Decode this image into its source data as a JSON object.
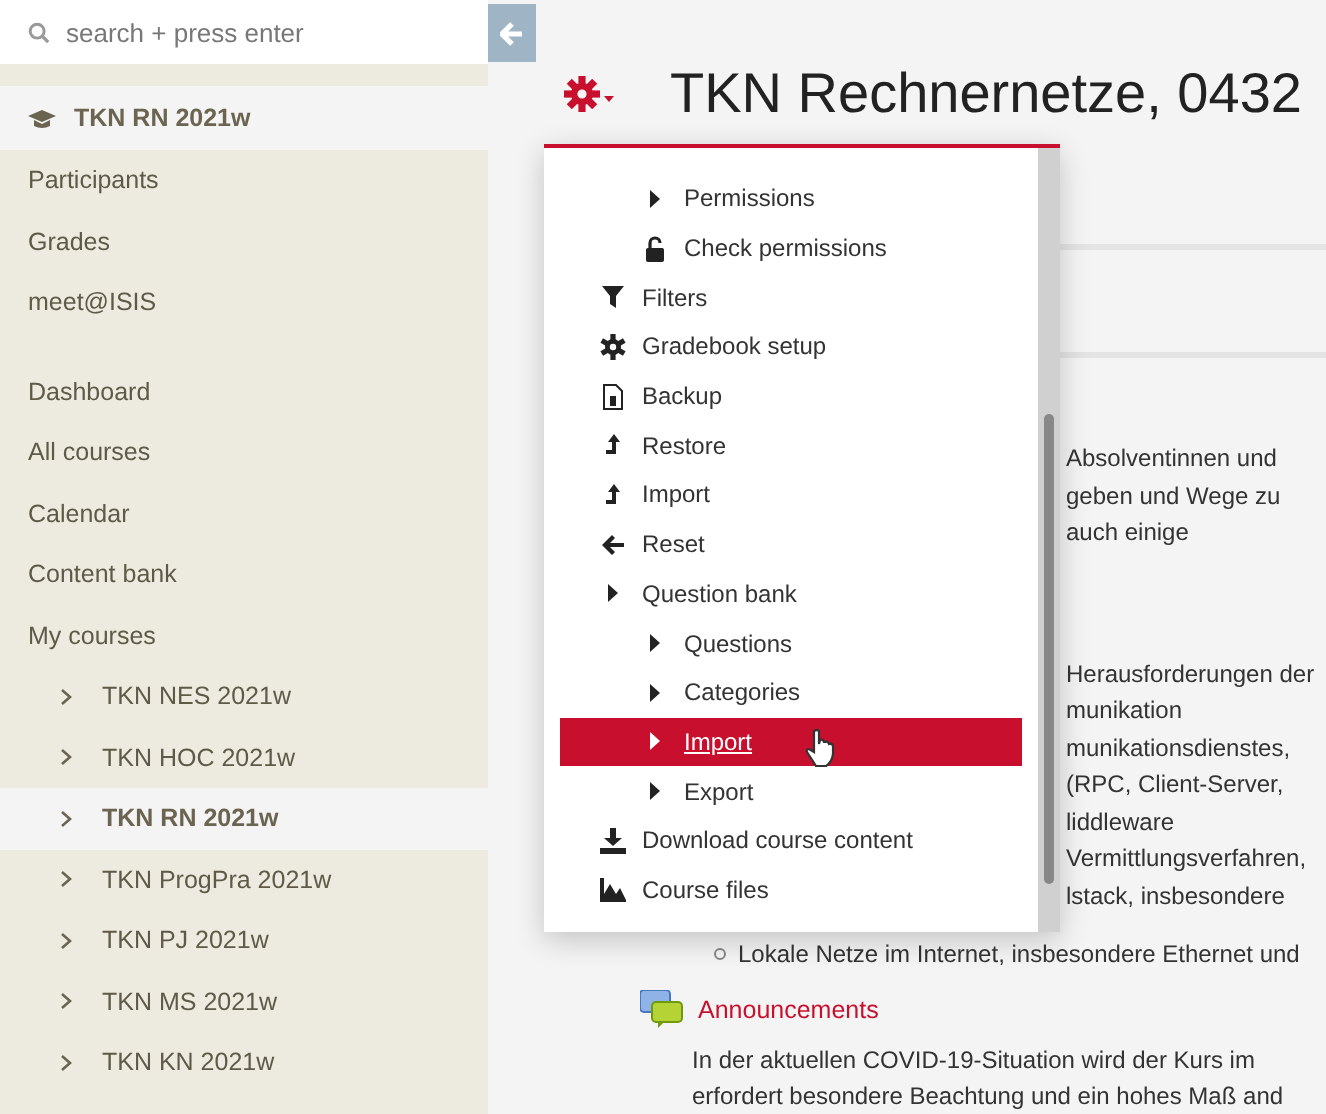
{
  "search": {
    "placeholder": "search + press enter"
  },
  "course_header": {
    "label": "TKN RN 2021w"
  },
  "nav_groups": [
    {
      "items": [
        {
          "label": "Participants"
        },
        {
          "label": "Grades"
        },
        {
          "label": "meet@ISIS"
        }
      ]
    },
    {
      "items": [
        {
          "label": "Dashboard"
        },
        {
          "label": "All courses"
        },
        {
          "label": "Calendar"
        },
        {
          "label": "Content bank"
        },
        {
          "label": "My courses",
          "children": [
            {
              "label": "TKN NES 2021w",
              "selected": false
            },
            {
              "label": "TKN HOC 2021w",
              "selected": false
            },
            {
              "label": "TKN RN 2021w",
              "selected": true
            },
            {
              "label": "TKN ProgPra 2021w",
              "selected": false
            },
            {
              "label": "TKN PJ 2021w",
              "selected": false
            },
            {
              "label": "TKN MS 2021w",
              "selected": false
            },
            {
              "label": "TKN KN 2021w",
              "selected": false
            }
          ]
        }
      ]
    }
  ],
  "page": {
    "title": "TKN Rechnernetze, 0432"
  },
  "menu": {
    "continued_children": [
      {
        "label": "Permissions",
        "kind": "caret",
        "selected": false
      },
      {
        "label": "Check permissions",
        "kind": "lock",
        "selected": false
      }
    ],
    "items": [
      {
        "label": "Filters",
        "kind": "filter",
        "selected": false
      },
      {
        "label": "Gradebook setup",
        "kind": "gear",
        "selected": false
      },
      {
        "label": "Backup",
        "kind": "file",
        "selected": false
      },
      {
        "label": "Restore",
        "kind": "up",
        "selected": false
      },
      {
        "label": "Import",
        "kind": "up",
        "selected": false
      },
      {
        "label": "Reset",
        "kind": "back",
        "selected": false
      },
      {
        "label": "Question bank",
        "kind": "caret",
        "selected": false,
        "children": [
          {
            "label": "Questions",
            "kind": "caret",
            "selected": false
          },
          {
            "label": "Categories",
            "kind": "caret",
            "selected": false
          },
          {
            "label": "Import",
            "kind": "caret",
            "selected": true
          },
          {
            "label": "Export",
            "kind": "caret",
            "selected": false
          }
        ]
      },
      {
        "label": "Download course content",
        "kind": "download",
        "selected": false
      },
      {
        "label": "Course files",
        "kind": "chart",
        "selected": false
      }
    ]
  },
  "content_fragments": [
    [
      "Absolventinnen und",
      "geben und Wege zu",
      "auch einige"
    ],
    [
      "Herausforderungen der",
      "munikation",
      "munikationsdienstes,",
      "(RPC, Client-Server,",
      "liddleware",
      "Vermittlungsverfahren,",
      "lstack, insbesondere"
    ]
  ],
  "bullet_line": "Lokale Netze im Internet, insbesondere Ethernet und",
  "announcements": {
    "title": "Announcements",
    "lines": [
      "In der aktuellen COVID-19-Situation wird der Kurs im",
      "erfordert besondere Beachtung und ein hohes Maß and"
    ]
  }
}
